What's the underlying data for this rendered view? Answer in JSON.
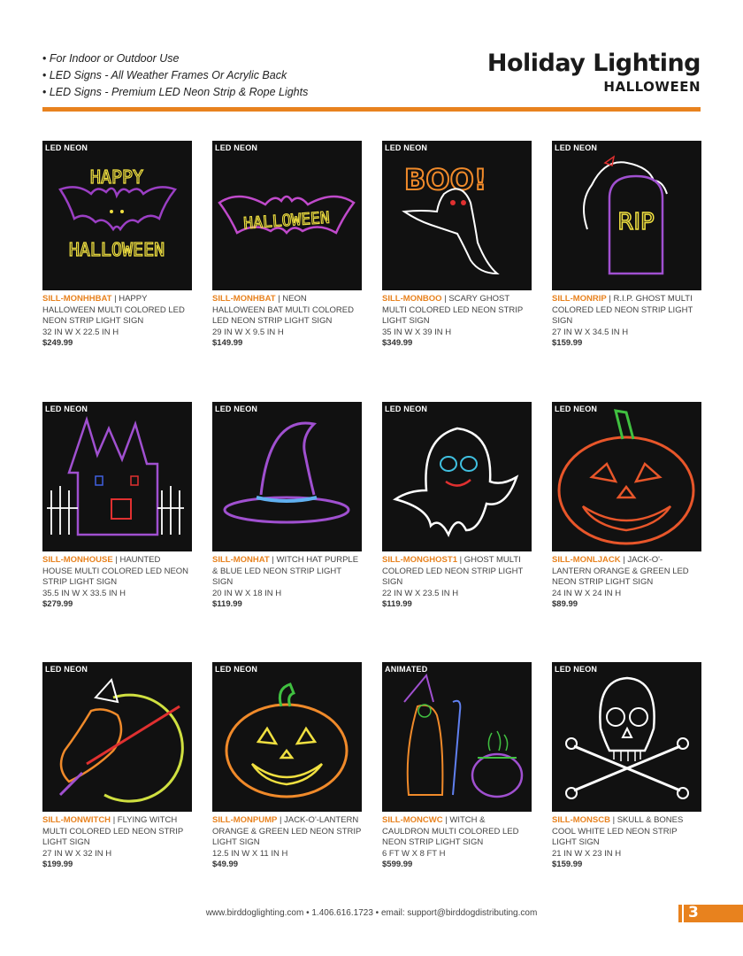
{
  "header": {
    "bullets": [
      "For Indoor or Outdoor Use",
      "LED Signs - All Weather Frames Or Acrylic Back",
      "LED Signs - Premium LED Neon Strip & Rope Lights"
    ],
    "title": "Holiday Lighting",
    "subtitle": "HALLOWEEN"
  },
  "colors": {
    "accent": "#e8821e",
    "thumb_bg": "#111111"
  },
  "products": [
    {
      "tag": "LED NEON",
      "sku": "SILL-MONHHBAT",
      "desc": "HAPPY HALLOWEEN MULTI COLORED LED NEON STRIP LIGHT SIGN",
      "size": "32 IN W X 22.5 IN H",
      "price": "$249.99",
      "icon": "happy-halloween-bat-icon"
    },
    {
      "tag": "LED NEON",
      "sku": "SILL-MONHBAT",
      "desc": "NEON HALLOWEEN BAT MULTI COLORED LED NEON STRIP LIGHT SIGN",
      "size": "29 IN W X 9.5 IN H",
      "price": "$149.99",
      "icon": "halloween-bat-icon"
    },
    {
      "tag": "LED NEON",
      "sku": "SILL-MONBOO",
      "desc": "SCARY GHOST MULTI COLORED LED NEON STRIP LIGHT SIGN",
      "size": "35 IN W X 39 IN H",
      "price": "$349.99",
      "icon": "boo-ghost-icon"
    },
    {
      "tag": "LED NEON",
      "sku": "SILL-MONRIP",
      "desc": "R.I.P. GHOST MULTI COLORED LED NEON STRIP LIGHT SIGN",
      "size": "27 IN W X 34.5 IN H",
      "price": "$159.99",
      "icon": "rip-ghost-icon"
    },
    {
      "tag": "LED NEON",
      "sku": "SILL-MONHOUSE",
      "desc": "HAUNTED HOUSE MULTI COLORED LED NEON STRIP LIGHT SIGN",
      "size": "35.5 IN W X 33.5 IN H",
      "price": "$279.99",
      "icon": "haunted-house-icon"
    },
    {
      "tag": "LED NEON",
      "sku": "SILL-MONHAT",
      "desc": "WITCH HAT PURPLE & BLUE LED NEON STRIP LIGHT SIGN",
      "size": "20 IN W X 18 IN H",
      "price": "$119.99",
      "icon": "witch-hat-icon"
    },
    {
      "tag": "LED NEON",
      "sku": "SILL-MONGHOST1",
      "desc": "GHOST MULTI COLORED LED NEON STRIP LIGHT SIGN",
      "size": "22 IN W X 23.5 IN H",
      "price": "$119.99",
      "icon": "ghost-icon"
    },
    {
      "tag": "LED NEON",
      "sku": "SILL-MONLJACK",
      "desc": "JACK-O'-LANTERN ORANGE & GREEN LED NEON STRIP LIGHT SIGN",
      "size": "24 IN W X 24 IN H",
      "price": "$89.99",
      "icon": "large-jack-o-lantern-icon"
    },
    {
      "tag": "LED NEON",
      "sku": "SILL-MONWITCH",
      "desc": "FLYING WITCH MULTI COLORED LED NEON STRIP LIGHT SIGN",
      "size": "27 IN W X 32 IN H",
      "price": "$199.99",
      "icon": "flying-witch-icon"
    },
    {
      "tag": "LED NEON",
      "sku": "SILL-MONPUMP",
      "desc": "JACK-O'-LANTERN ORANGE & GREEN LED NEON STRIP LIGHT SIGN",
      "size": "12.5 IN W X 11 IN H",
      "price": "$49.99",
      "icon": "pumpkin-icon"
    },
    {
      "tag": "ANIMATED",
      "sku": "SILL-MONCWC",
      "desc": "WITCH & CAULDRON MULTI COLORED LED NEON STRIP LIGHT SIGN",
      "size": "6 FT W X 8 FT H",
      "price": "$599.99",
      "icon": "witch-cauldron-icon"
    },
    {
      "tag": "LED NEON",
      "sku": "SILL-MONSCB",
      "desc": "SKULL & BONES COOL WHITE LED NEON STRIP LIGHT SIGN",
      "size": "21 IN W X 23 IN H",
      "price": "$159.99",
      "icon": "skull-and-bones-icon"
    }
  ],
  "footer": {
    "text": "www.birddoglighting.com • 1.406.616.1723 • email: support@birddogdistributing.com",
    "page_number": "3"
  }
}
